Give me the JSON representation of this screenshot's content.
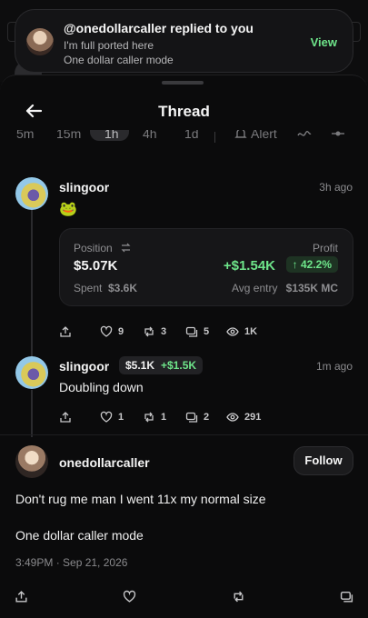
{
  "notification": {
    "title": "@onedollarcaller replied to you",
    "line1": "I'm full ported here",
    "line2": "One dollar caller mode",
    "action": "View"
  },
  "header": {
    "title": "Thread",
    "timeframes": [
      "5m",
      "15m",
      "1h",
      "4h",
      "1d"
    ],
    "alert_label": "Alert"
  },
  "post1": {
    "user": "slingoor",
    "time": "3h ago",
    "emoji": "🐸",
    "card": {
      "position_label": "Position",
      "position_value": "$5.07K",
      "profit_label": "Profit",
      "profit_value": "+$1.54K",
      "profit_pct": "↑ 42.2%",
      "spent_label": "Spent",
      "spent_value": "$3.6K",
      "avg_label": "Avg entry",
      "avg_value": "$135K MC"
    },
    "stats": {
      "likes": "9",
      "reposts": "3",
      "replies": "5",
      "views": "1K"
    }
  },
  "post2": {
    "user": "slingoor",
    "pos_badge": "$5.1K",
    "pnl_badge": "+$1.5K",
    "time": "1m ago",
    "text": "Doubling down",
    "stats": {
      "likes": "1",
      "reposts": "1",
      "replies": "2",
      "views": "291"
    }
  },
  "main_post": {
    "user": "onedollarcaller",
    "follow_label": "Follow",
    "line1": "Don't rug me man I went 11x my normal size",
    "line2": "One dollar caller mode",
    "timestamp": "3:49PM · Sep 21, 2026"
  },
  "colors": {
    "accent_green": "#6ee58a",
    "background": "#0b0b0c",
    "card": "#161618"
  }
}
